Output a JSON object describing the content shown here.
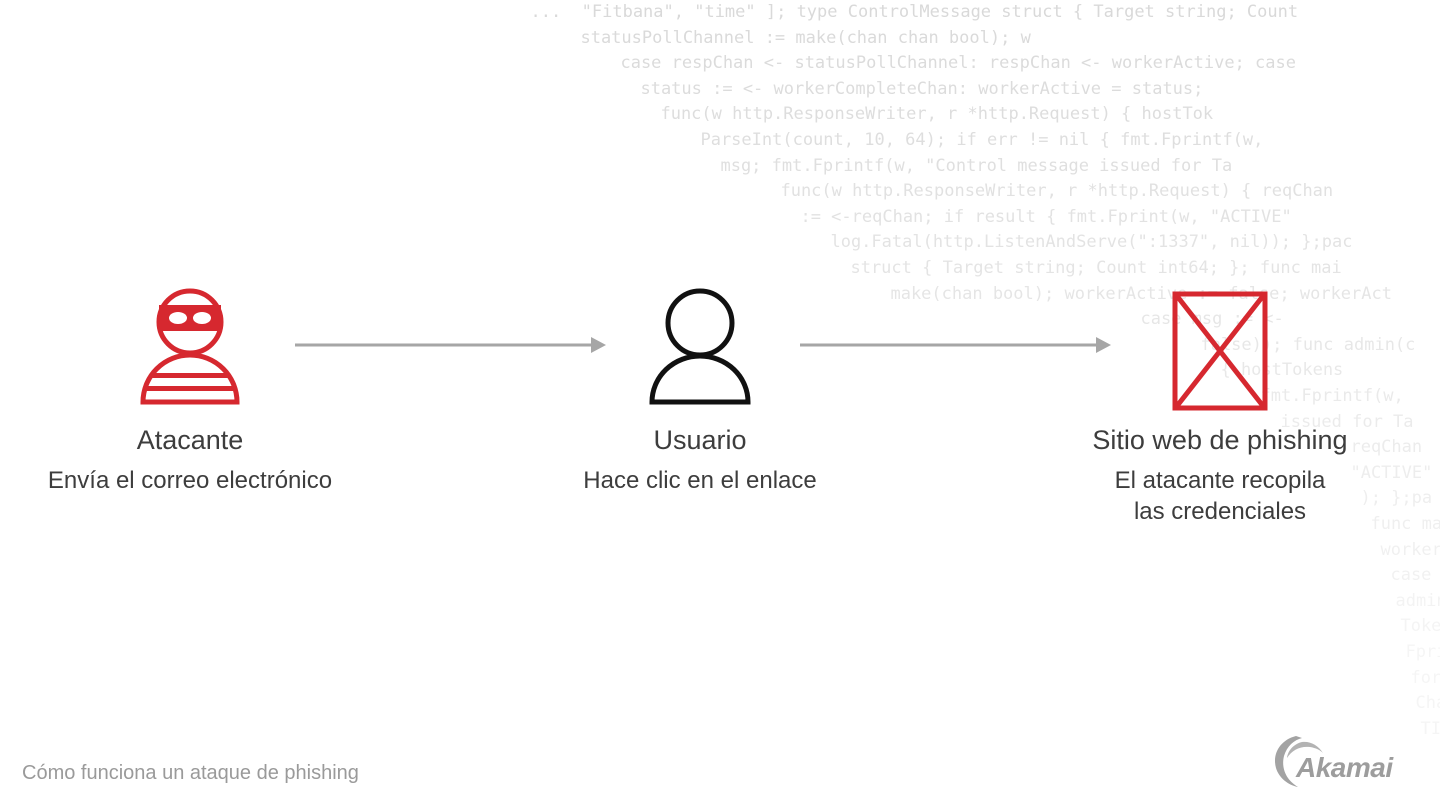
{
  "diagram": {
    "caption": "Cómo funciona un ataque de phishing",
    "accent_color": "#d6282f",
    "steps": [
      {
        "icon": "burglar-icon",
        "title": "Atacante",
        "description": "Envía el correo electrónico"
      },
      {
        "icon": "user-icon",
        "title": "Usuario",
        "description": "Hace clic en el enlace"
      },
      {
        "icon": "broken-image-icon",
        "title": "Sitio web de phishing",
        "description_lines": [
          "El atacante recopila",
          "las credenciales"
        ]
      }
    ],
    "connectors": [
      {
        "from": "Atacante",
        "to": "Usuario"
      },
      {
        "from": "Usuario",
        "to": "Sitio web de phishing"
      }
    ]
  },
  "brand": {
    "logo_text": "Akamai"
  },
  "background_code": [
    "  ...  \"Fitbana\", \"time\" ]; type ControlMessage struct { Target string; Count",
    "  statusPollChannel := make(chan chan bool); w",
    "  case respChan <- statusPollChannel: respChan <- workerActive; case",
    "  status := <- workerCompleteChan: workerActive = status;",
    "  func(w http.ResponseWriter, r *http.Request) { hostTok",
    "  ParseInt(count, 10, 64); if err != nil { fmt.Fprintf(w,",
    "  msg; fmt.Fprintf(w, \"Control message issued for Ta",
    "  func(w http.ResponseWriter, r *http.Request) { reqChan",
    "  := <-reqChan; if result { fmt.Fprint(w, \"ACTIVE\"",
    "  log.Fatal(http.ListenAndServe(\":1337\", nil)); };pac",
    "  struct { Target string; Count int64; }; func mai",
    "  make(chan bool); workerActive := false; workerAct",
    "  case msg := <-",
    "  false)); func admin(c",
    "  { hostTokens",
    "  fmt.Fprintf(w,",
    "  issued for Ta",
    "  reqChan",
    "  \"ACTIVE\"",
    "  ); };pa",
    "  func ma",
    "  workerAc",
    "  case",
    "  admin(",
    "  Tokens",
    "  Fprintf",
    "  for",
    "  Chan",
    "  TIVE"
  ]
}
